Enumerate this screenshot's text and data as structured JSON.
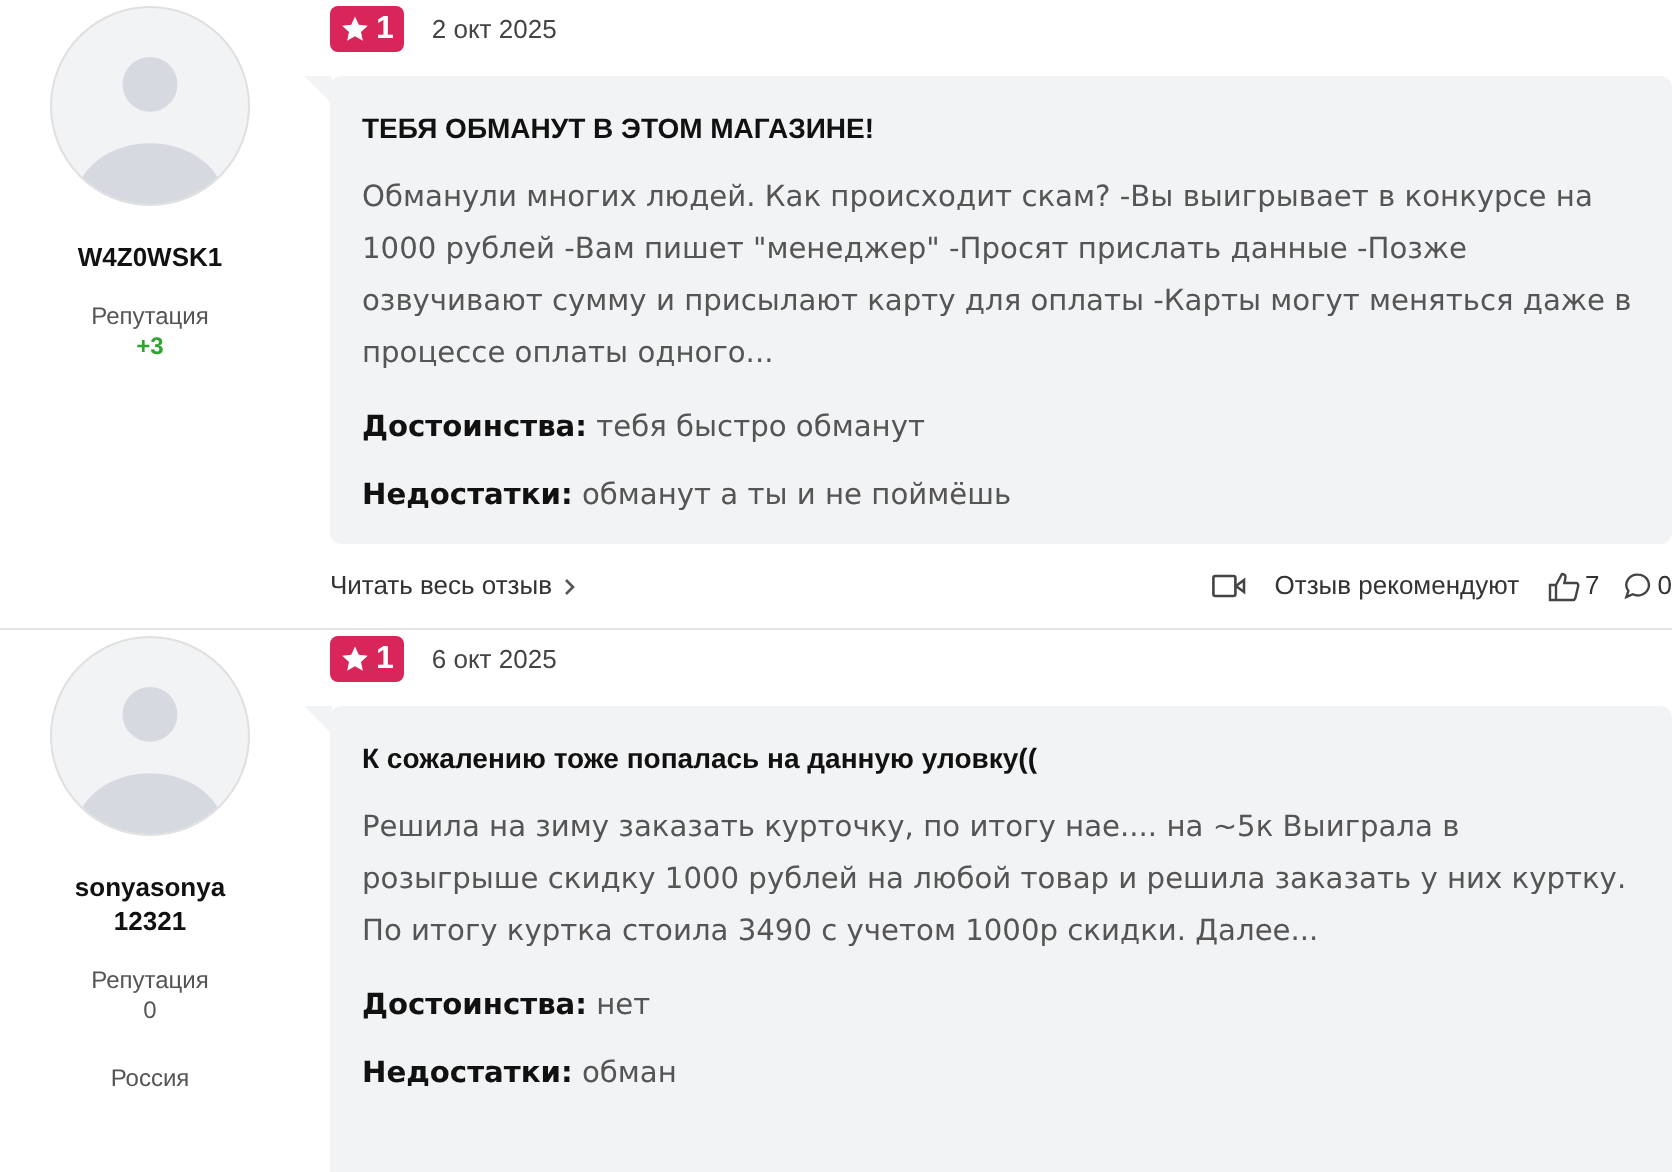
{
  "reviews": [
    {
      "author": {
        "name": "W4Z0WSK1",
        "reputation_label": "Репутация",
        "reputation": "+3",
        "positive": true
      },
      "rating": "1",
      "date": "2 окт 2025",
      "title": "ТЕБЯ ОБМАНУТ В ЭТОМ МАГАЗИНЕ!",
      "text": "Обманули многих людей. Как происходит скам? -Вы выигрывает в конкурсе на 1000 рублей -Вам пишет \"менеджер\" -Просят прислать данные -Позже озвучивают сумму и присылают карту для оплаты -Карты могут меняться даже в процессе оплаты одного...",
      "pros_label": "Достоинства:",
      "pros": "тебя быстро обманут",
      "cons_label": "Недостатки:",
      "cons": "обманут а ты и не поймёшь",
      "footer": {
        "read_more": "Читать весь отзыв",
        "recommend": "Отзыв рекомендуют",
        "likes": "7",
        "comments": "0"
      }
    },
    {
      "author": {
        "name": "sonyasonya12321",
        "reputation_label": "Репутация",
        "reputation": "0",
        "positive": false,
        "country": "Россия"
      },
      "rating": "1",
      "date": "6 окт 2025",
      "title": "К сожалению тоже попалась на данную уловку((",
      "text": "Решила на зиму заказать курточку, по итогу нае.... на ~5к Выиграла в розыгрыше скидку 1000 рублей на любой товар и решила заказать у них куртку. По итогу куртка стоила 3490 с учетом 1000р скидки. Далее...",
      "pros_label": "Достоинства:",
      "pros": "нет",
      "cons_label": "Недостатки:",
      "cons": "обман"
    }
  ]
}
